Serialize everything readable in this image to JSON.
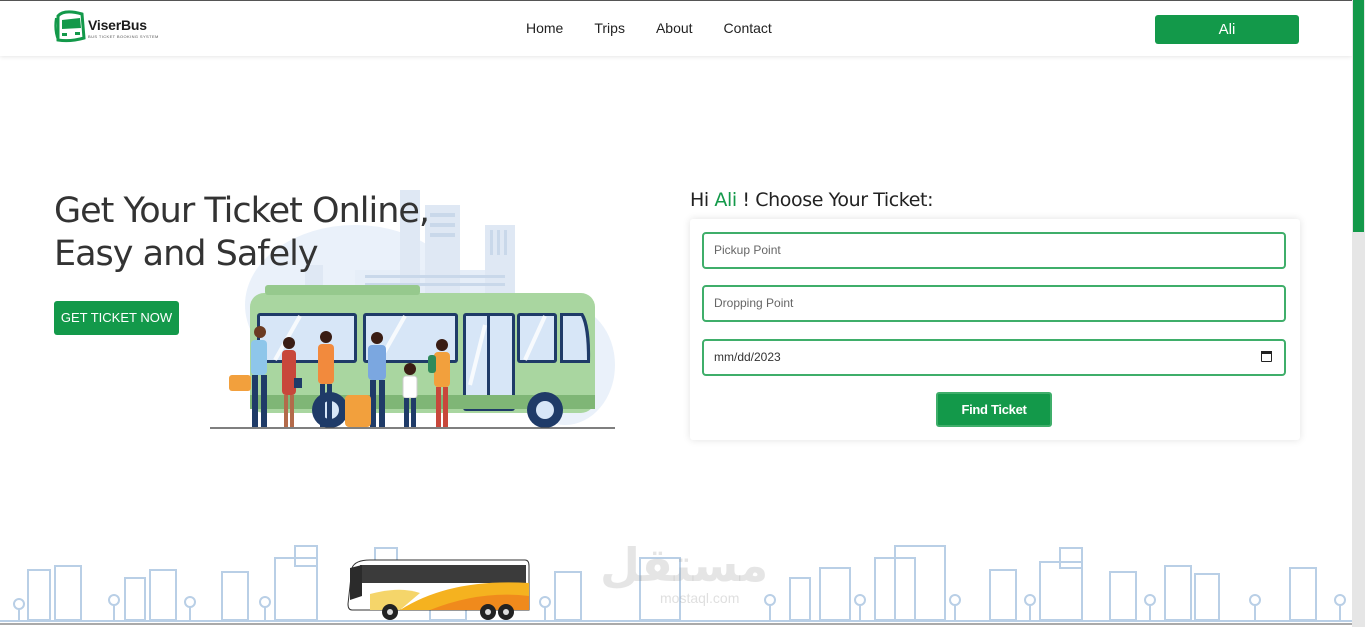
{
  "brand": {
    "name_part1": "Viser",
    "name_part2": "Bus",
    "tagline": "BUS TICKET BOOKING SYSTEM",
    "accent": "#13994a"
  },
  "nav": {
    "items": [
      {
        "label": "Home"
      },
      {
        "label": "Trips"
      },
      {
        "label": "About"
      },
      {
        "label": "Contact"
      }
    ]
  },
  "user": {
    "button_label": "Ali"
  },
  "hero": {
    "title_line1": "Get Your Ticket Online,",
    "title_line2": "Easy and Safely",
    "cta_label": "GET TICKET NOW"
  },
  "booking": {
    "greeting_prefix": "Hi",
    "greeting_name": "Ali",
    "greeting_suffix": "! Choose Your Ticket:",
    "pickup_placeholder": "Pickup Point",
    "dropping_placeholder": "Dropping Point",
    "date_value": "mm/dd/2023",
    "submit_label": "Find Ticket"
  },
  "watermark": {
    "text": "مستقل",
    "sub": "mostaql.com"
  },
  "icons": {
    "logo": "bus-logo-icon",
    "calendar": "calendar-icon"
  }
}
